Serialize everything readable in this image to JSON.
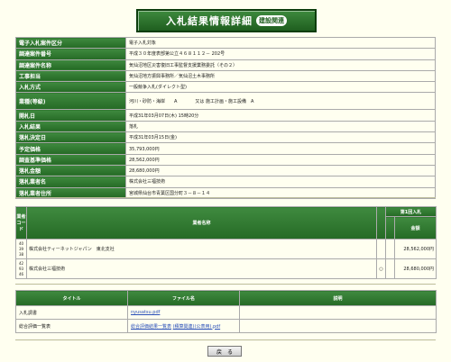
{
  "header": {
    "title": "入札結果情報詳細",
    "subtitle": "建設関連"
  },
  "info": [
    {
      "label": "電子入札案件区分",
      "value": "電子入札対象"
    },
    {
      "label": "調達案件番号",
      "value": "平成３０年度表部第公立４６８１１２－ 202号"
    },
    {
      "label": "調達案件名称",
      "value": "気仙沼地区災害復旧工事監督支援業務委託（その２）"
    },
    {
      "label": "工事担当",
      "value": "気仙沼地方振興事務所／気仙沼土木事務所"
    },
    {
      "label": "入札方式",
      "value": "一般競争入札(ダイレクト型)"
    },
    {
      "label": "業種(等級)",
      "value": "河川・砂防・海岸　　A　　　　又は 施工計画・施工設備　A"
    },
    {
      "label": "開札日",
      "value": "平成31年03月07日(木) 15時20分"
    },
    {
      "label": "入札結果",
      "value": "落札"
    },
    {
      "label": "落札決定日",
      "value": "平成31年03月15日(金)"
    },
    {
      "label": "予定価格",
      "value": "35,793,000円"
    },
    {
      "label": "調査基準価格",
      "value": "28,562,000円"
    },
    {
      "label": "落札金額",
      "value": "28,680,000円"
    },
    {
      "label": "落札業者名",
      "value": "株式会社三福技術"
    },
    {
      "label": "落札業者住所",
      "value": "宮城県仙台市青葉区国分町３－８－１４"
    }
  ],
  "bids": {
    "headers": {
      "no": "業者コード",
      "name": "業者名称",
      "bid_header": "第1回入札",
      "amount": "金額"
    },
    "rows": [
      {
        "code": "40 39 38",
        "name": "株式会社ティーネットジャパン　東北支社",
        "mark": "",
        "amount": "28,562,000円"
      },
      {
        "code": "42 93 46",
        "name": "株式会社三福技術",
        "mark": "○",
        "amount": "28,680,000円"
      }
    ]
  },
  "docs": {
    "headers": {
      "title": "タイトル",
      "file": "ファイル名",
      "note": "説明"
    },
    "rows": [
      {
        "title": "入札調書",
        "files": [
          "nyusatsu.pdf"
        ]
      },
      {
        "title": "総合評価一覧表",
        "files": [
          "総合評価結果一覧表",
          "(積算関連)(公表用).pdf"
        ]
      }
    ]
  },
  "back_label": "戻　る"
}
